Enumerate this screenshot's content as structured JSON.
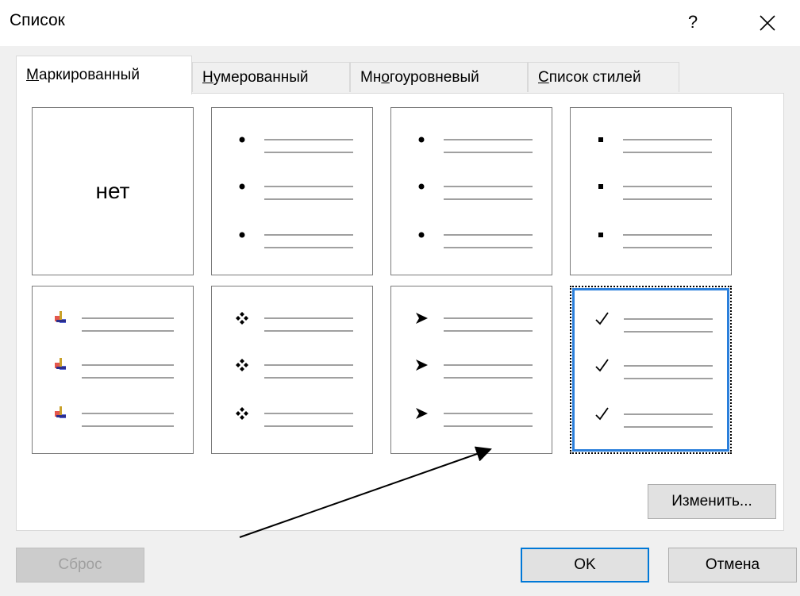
{
  "window": {
    "title": "Список",
    "help_label": "?",
    "close_icon": "close-icon"
  },
  "tabs": [
    {
      "label": "Маркированный",
      "accelerator": "М",
      "active": true
    },
    {
      "label": "Нумерованный",
      "accelerator": "Н",
      "active": false
    },
    {
      "label": "Многоуровневый",
      "accelerator": "о",
      "active": false
    },
    {
      "label": "Список стилей",
      "accelerator": "С",
      "active": false
    }
  ],
  "bullet_gallery": {
    "none_label": "нет",
    "tiles": [
      {
        "bullet": "none"
      },
      {
        "bullet": "round-dot-icon"
      },
      {
        "bullet": "round-dot-icon"
      },
      {
        "bullet": "square-icon"
      },
      {
        "bullet": "colored-picture-bullet-icon"
      },
      {
        "bullet": "diamond-four-dots-icon"
      },
      {
        "bullet": "arrowhead-icon"
      },
      {
        "bullet": "checkmark-icon",
        "selected": true
      }
    ]
  },
  "buttons": {
    "modify": "Изменить...",
    "reset": "Сброс",
    "ok": "OK",
    "cancel": "Отмена"
  },
  "colors": {
    "selection_border": "#2b7fdb",
    "default_button_border": "#0078d7"
  }
}
